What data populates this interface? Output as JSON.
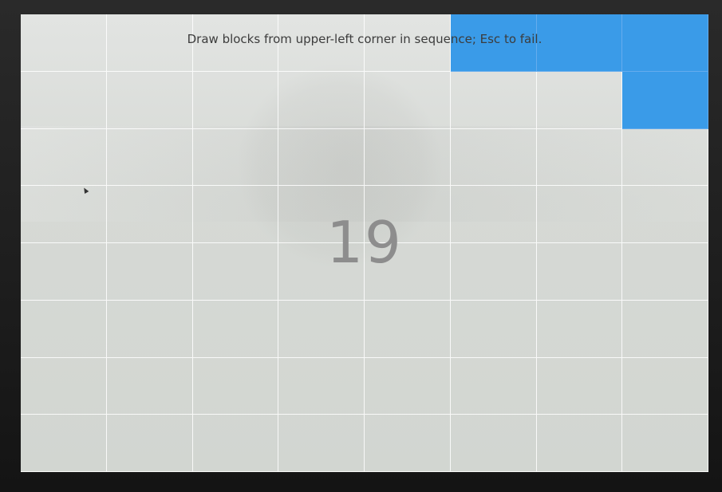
{
  "app": {
    "instruction": "Draw blocks from upper-left corner in sequence; Esc to fail.",
    "counter": "19"
  },
  "grid": {
    "columns": 8,
    "rows": 8,
    "filled_cells": [
      [
        0,
        5
      ],
      [
        0,
        6
      ],
      [
        0,
        7
      ],
      [
        1,
        7
      ]
    ],
    "cell_color": "#d8dbd7",
    "filled_color": "#3a9be8",
    "line_color": "#ffffff"
  },
  "colors": {
    "accent": "#3a9be8",
    "text": "#3c3c3c",
    "counter_text": "#8d8d8d"
  }
}
